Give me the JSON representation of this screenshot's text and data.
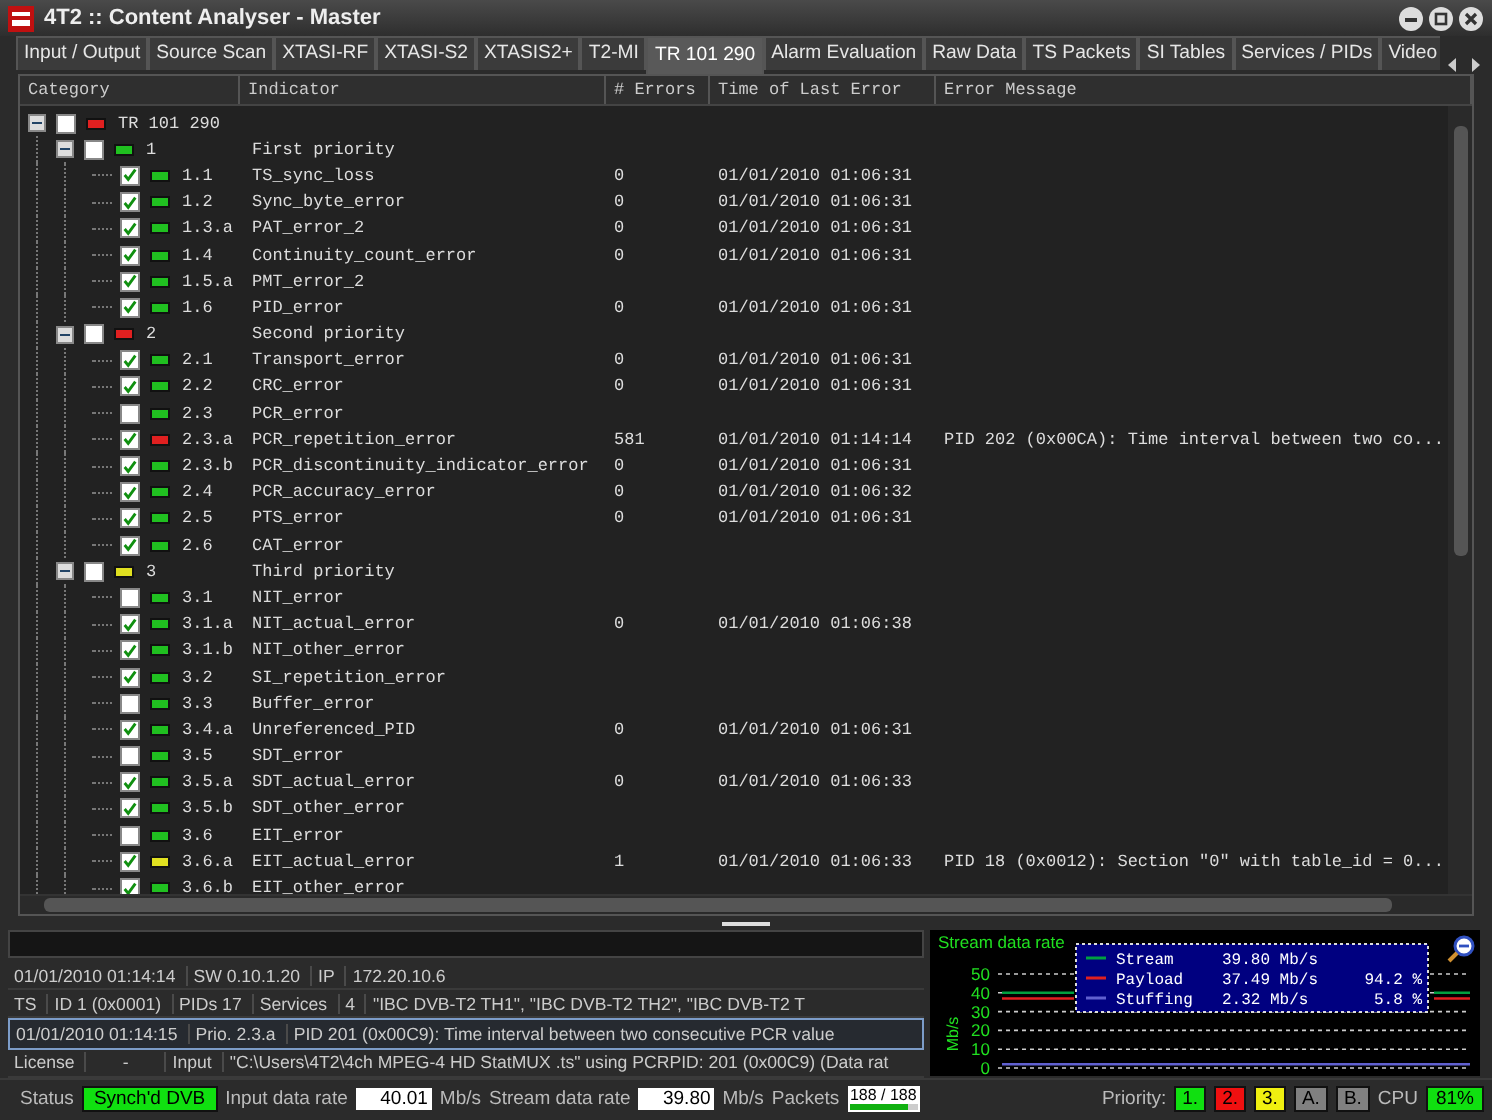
{
  "window": {
    "title": "4T2 :: Content Analyser - Master"
  },
  "tabs": [
    {
      "label": "Input / Output",
      "selected": false
    },
    {
      "label": "Source Scan",
      "selected": false
    },
    {
      "label": "XTASI-RF",
      "selected": false
    },
    {
      "label": "XTASI-S2",
      "selected": false
    },
    {
      "label": "XTASIS2+",
      "selected": false
    },
    {
      "label": "T2-MI",
      "selected": false
    },
    {
      "label": "TR 101 290",
      "selected": true
    },
    {
      "label": "Alarm Evaluation",
      "selected": false
    },
    {
      "label": "Raw Data",
      "selected": false
    },
    {
      "label": "TS Packets",
      "selected": false
    },
    {
      "label": "SI Tables",
      "selected": false
    },
    {
      "label": "Services / PIDs",
      "selected": false
    },
    {
      "label": "Video",
      "selected": false
    }
  ],
  "table": {
    "columns": [
      "Category",
      "Indicator",
      "# Errors",
      "Time of Last Error",
      "Error Message"
    ],
    "tree": [
      {
        "code": "TR 101 290",
        "checked": false,
        "color": "#e02020",
        "expanded": true,
        "children": [
          {
            "code": "1",
            "indicator": "First priority",
            "checked": false,
            "color": "#20c020",
            "expanded": true,
            "children": [
              {
                "code": "1.1",
                "indicator": "TS_sync_loss",
                "checked": true,
                "color": "#20c020",
                "errors": "0",
                "time": "01/01/2010 01:06:31"
              },
              {
                "code": "1.2",
                "indicator": "Sync_byte_error",
                "checked": true,
                "color": "#20c020",
                "errors": "0",
                "time": "01/01/2010 01:06:31"
              },
              {
                "code": "1.3.a",
                "indicator": "PAT_error_2",
                "checked": true,
                "color": "#20c020",
                "errors": "0",
                "time": "01/01/2010 01:06:31"
              },
              {
                "code": "1.4",
                "indicator": "Continuity_count_error",
                "checked": true,
                "color": "#20c020",
                "errors": "0",
                "time": "01/01/2010 01:06:31"
              },
              {
                "code": "1.5.a",
                "indicator": "PMT_error_2",
                "checked": true,
                "color": "#20c020"
              },
              {
                "code": "1.6",
                "indicator": "PID_error",
                "checked": true,
                "color": "#20c020",
                "errors": "0",
                "time": "01/01/2010 01:06:31"
              }
            ]
          },
          {
            "code": "2",
            "indicator": "Second priority",
            "checked": false,
            "color": "#e02020",
            "expanded": true,
            "children": [
              {
                "code": "2.1",
                "indicator": "Transport_error",
                "checked": true,
                "color": "#20c020",
                "errors": "0",
                "time": "01/01/2010 01:06:31"
              },
              {
                "code": "2.2",
                "indicator": "CRC_error",
                "checked": true,
                "color": "#20c020",
                "errors": "0",
                "time": "01/01/2010 01:06:31"
              },
              {
                "code": "2.3",
                "indicator": "PCR_error",
                "checked": false,
                "color": "#20c020"
              },
              {
                "code": "2.3.a",
                "indicator": "PCR_repetition_error",
                "checked": true,
                "color": "#e02020",
                "errors": "581",
                "time": "01/01/2010 01:14:14",
                "message": "PID 202 (0x00CA): Time interval between two co..."
              },
              {
                "code": "2.3.b",
                "indicator": "PCR_discontinuity_indicator_error",
                "checked": true,
                "color": "#20c020",
                "errors": "0",
                "time": "01/01/2010 01:06:31"
              },
              {
                "code": "2.4",
                "indicator": "PCR_accuracy_error",
                "checked": true,
                "color": "#20c020",
                "errors": "0",
                "time": "01/01/2010 01:06:32"
              },
              {
                "code": "2.5",
                "indicator": "PTS_error",
                "checked": true,
                "color": "#20c020",
                "errors": "0",
                "time": "01/01/2010 01:06:31"
              },
              {
                "code": "2.6",
                "indicator": "CAT_error",
                "checked": true,
                "color": "#20c020"
              }
            ]
          },
          {
            "code": "3",
            "indicator": "Third priority",
            "checked": false,
            "color": "#e0e020",
            "expanded": true,
            "children": [
              {
                "code": "3.1",
                "indicator": "NIT_error",
                "checked": false,
                "color": "#20c020"
              },
              {
                "code": "3.1.a",
                "indicator": "NIT_actual_error",
                "checked": true,
                "color": "#20c020",
                "errors": "0",
                "time": "01/01/2010 01:06:38"
              },
              {
                "code": "3.1.b",
                "indicator": "NIT_other_error",
                "checked": true,
                "color": "#20c020"
              },
              {
                "code": "3.2",
                "indicator": "SI_repetition_error",
                "checked": true,
                "color": "#20c020"
              },
              {
                "code": "3.3",
                "indicator": "Buffer_error",
                "checked": false,
                "color": "#20c020"
              },
              {
                "code": "3.4.a",
                "indicator": "Unreferenced_PID",
                "checked": true,
                "color": "#20c020",
                "errors": "0",
                "time": "01/01/2010 01:06:31"
              },
              {
                "code": "3.5",
                "indicator": "SDT_error",
                "checked": false,
                "color": "#20c020"
              },
              {
                "code": "3.5.a",
                "indicator": "SDT_actual_error",
                "checked": true,
                "color": "#20c020",
                "errors": "0",
                "time": "01/01/2010 01:06:33"
              },
              {
                "code": "3.5.b",
                "indicator": "SDT_other_error",
                "checked": true,
                "color": "#20c020"
              },
              {
                "code": "3.6",
                "indicator": "EIT_error",
                "checked": false,
                "color": "#20c020"
              },
              {
                "code": "3.6.a",
                "indicator": "EIT_actual_error",
                "checked": true,
                "color": "#e0e020",
                "errors": "1",
                "time": "01/01/2010 01:06:33",
                "message": "PID 18 (0x0012): Section \"0\" with table_id = 0..."
              },
              {
                "code": "3.6.b",
                "indicator": "EIT_other_error",
                "checked": true,
                "color": "#20c020"
              }
            ]
          }
        ]
      }
    ]
  },
  "info": {
    "lines": [
      [
        "01/01/2010 01:14:14",
        "SW 0.10.1.20",
        "IP",
        "172.20.10.6"
      ],
      [
        "TS",
        "ID 1 (0x0001)",
        "PIDs 17",
        "Services",
        "4",
        "\"IBC DVB-T2 TH1\", \"IBC DVB-T2 TH2\", \"IBC DVB-T2 T"
      ]
    ],
    "alarm": [
      "01/01/2010 01:14:15",
      "Prio. 2.3.a",
      "PID 201 (0x00C9): Time interval between two consecutive PCR value"
    ],
    "license": [
      "License",
      "-",
      "Input",
      "\"C:\\Users\\4T2\\4ch MPEG-4 HD StatMUX .ts\" using PCRPID: 201 (0x00C9) (Data rat"
    ]
  },
  "chart": {
    "legend_readings": [
      {
        "rate": "39.80 Mb/s"
      },
      {
        "rate": "37.49 Mb/s",
        "percent": "94.2 %"
      },
      {
        "rate": "2.32 Mb/s",
        "percent": "5.8 %"
      }
    ],
    "chart_data": {
      "type": "line",
      "title": "Stream data rate",
      "ylabel": "Mb/s",
      "ylim": [
        0,
        50
      ],
      "yticks": [
        0,
        10,
        20,
        30,
        40,
        50
      ],
      "grid": true,
      "legend": true,
      "series": [
        {
          "name": "Stream",
          "color": "#00a040",
          "values": [
            40,
            40,
            40,
            null,
            null,
            null,
            null,
            null,
            null,
            null,
            null,
            null,
            40,
            40
          ]
        },
        {
          "name": "Payload",
          "color": "#e02020",
          "values": [
            37,
            37,
            37,
            null,
            null,
            null,
            null,
            null,
            null,
            null,
            null,
            null,
            37,
            37
          ]
        },
        {
          "name": "Stuffing",
          "color": "#6060d0",
          "values": [
            2,
            2,
            2,
            2,
            2,
            2,
            2,
            2,
            2,
            2,
            2,
            2,
            2,
            2
          ]
        }
      ]
    }
  },
  "status_bar": {
    "status_label": "Status",
    "status": "Synch'd DVB",
    "input_label": "Input data rate",
    "input_rate": "40.01",
    "input_unit": "Mb/s",
    "stream_label": "Stream data rate",
    "stream_rate": "39.80",
    "stream_unit": "Mb/s",
    "packets_label": "Packets",
    "packets": {
      "text": "188 / 188",
      "level": 0.85
    },
    "priority_label": "Priority:",
    "priorities": [
      {
        "label": "1.",
        "color": "#10e010"
      },
      {
        "label": "2.",
        "color": "#f01010"
      },
      {
        "label": "3.",
        "color": "#f0f010"
      },
      {
        "label": "A.",
        "color": "#808080"
      },
      {
        "label": "B.",
        "color": "#808080"
      }
    ],
    "cpu_label": "CPU",
    "cpu": "81%"
  }
}
